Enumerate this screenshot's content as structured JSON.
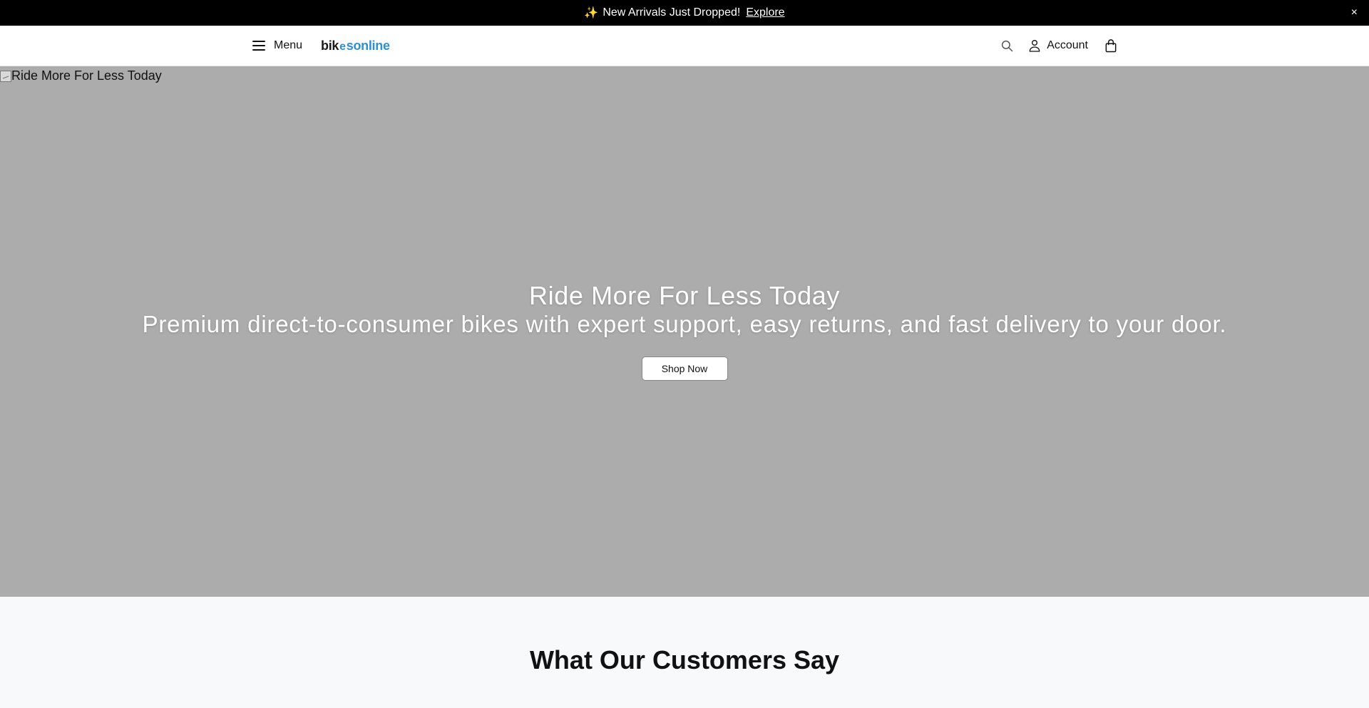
{
  "announcement": {
    "emoji": "✨",
    "text": "New Arrivals Just Dropped!",
    "link_label": "Explore",
    "close_glyph": "×"
  },
  "header": {
    "menu_label": "Menu",
    "logo": {
      "part1": "bik",
      "mark": "e",
      "part2": "s",
      "part3": "online"
    },
    "account_label": "Account",
    "icons": [
      "hamburger-icon",
      "search-icon",
      "user-icon",
      "shopping-bag-icon"
    ]
  },
  "hero": {
    "image_alt": "Ride More For Less Today",
    "title": "Ride More For Less Today",
    "subtitle": "Premium direct-to-consumer bikes with expert support, easy returns, and fast delivery to your door.",
    "cta_label": "Shop Now"
  },
  "reviews": {
    "heading": "What Our Customers Say"
  },
  "colors": {
    "announcement_bg": "#000000",
    "hero_bg": "#acacac",
    "brand_blue": "#2d8fd5",
    "section_bg": "#f8f9fb"
  }
}
